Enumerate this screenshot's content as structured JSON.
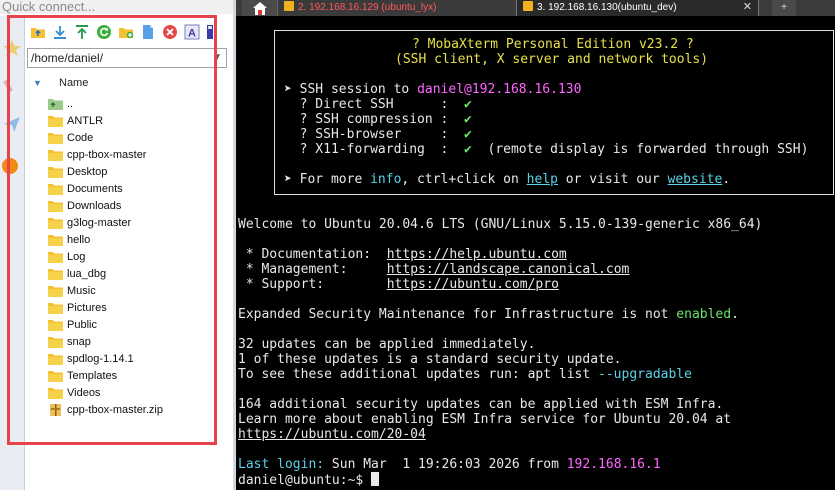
{
  "quick_connect": {
    "placeholder": "Quick connect..."
  },
  "tabs": {
    "tab1": "2. 192.168.16.129 (ubuntu_lyx)",
    "tab2": "3. 192.168.16.130(ubuntu_dev)",
    "close_glyph": "✕",
    "add_glyph": "+"
  },
  "file_browser": {
    "path": "/home/daniel/",
    "column_header": "Name",
    "toolbar_icons": [
      "upload-folder-icon",
      "download-icon",
      "upload-icon",
      "refresh-icon",
      "new-folder-icon",
      "new-file-icon",
      "delete-icon",
      "rename-icon",
      "more-icon"
    ],
    "items": [
      {
        "name": "..",
        "type": "parent"
      },
      {
        "name": "ANTLR",
        "type": "folder"
      },
      {
        "name": "Code",
        "type": "folder"
      },
      {
        "name": "cpp-tbox-master",
        "type": "folder"
      },
      {
        "name": "Desktop",
        "type": "folder"
      },
      {
        "name": "Documents",
        "type": "folder"
      },
      {
        "name": "Downloads",
        "type": "folder"
      },
      {
        "name": "g3log-master",
        "type": "folder"
      },
      {
        "name": "hello",
        "type": "folder"
      },
      {
        "name": "Log",
        "type": "folder"
      },
      {
        "name": "lua_dbg",
        "type": "folder"
      },
      {
        "name": "Music",
        "type": "folder"
      },
      {
        "name": "Pictures",
        "type": "folder"
      },
      {
        "name": "Public",
        "type": "folder"
      },
      {
        "name": "snap",
        "type": "folder"
      },
      {
        "name": "spdlog-1.14.1",
        "type": "folder"
      },
      {
        "name": "Templates",
        "type": "folder"
      },
      {
        "name": "Videos",
        "type": "folder"
      },
      {
        "name": "cpp-tbox-master.zip",
        "type": "zip"
      }
    ]
  },
  "terminal": {
    "banner": {
      "title": "? MobaXterm Personal Edition v23.2 ?",
      "subtitle": "(SSH client, X server and network tools)",
      "session_prefix": "➤ SSH session to ",
      "session_user_host": "daniel@192.168.16.130",
      "direct_ssh": "  ? Direct SSH      :  ",
      "ssh_compression": "  ? SSH compression :  ",
      "ssh_browser": "  ? SSH-browser     :  ",
      "x11_forwarding": "  ? X11-forwarding  :  ",
      "check": "✔",
      "x11_note": "  (remote display is forwarded through SSH)",
      "more_prefix": "➤ For more ",
      "more_info": "info",
      "more_mid": ", ctrl+click on ",
      "more_help": "help",
      "more_visit": " or visit our ",
      "more_website": "website",
      "more_end": "."
    },
    "welcome": "Welcome to Ubuntu 20.04.6 LTS (GNU/Linux 5.15.0-139-generic x86_64)",
    "doc_label": " * Documentation:  ",
    "doc_url": "https://help.ubuntu.com",
    "mgmt_label": " * Management:     ",
    "mgmt_url": "https://landscape.canonical.com",
    "support_label": " * Support:        ",
    "support_url": "https://ubuntu.com/pro",
    "esm_prefix": "Expanded Security Maintenance for Infrastructure is not ",
    "esm_enabled": "enabled",
    "esm_end": ".",
    "updates_1": "32 updates can be applied immediately.",
    "updates_2": "1 of these updates is a standard security update.",
    "updates_3_prefix": "To see these additional updates run: apt list ",
    "updates_3_flag": "--upgradable",
    "esm_1": "164 additional security updates can be applied with ESM Infra.",
    "esm_2": "Learn more about enabling ESM Infra service for Ubuntu 20.04 at",
    "esm_3": "https://ubuntu.com/20-04",
    "last_login_label": "Last login:",
    "last_login_time": " Sun Mar  1 19:26:03 2026 from ",
    "last_login_ip": "192.168.16.1",
    "prompt": "daniel@ubuntu:~$ "
  },
  "colors": {
    "frame": "#e8434b",
    "term_bg": "#000000",
    "yellow": "#e8e04a",
    "magenta": "#ff66ff",
    "green": "#6be36b",
    "cyan": "#5ad2e8"
  }
}
